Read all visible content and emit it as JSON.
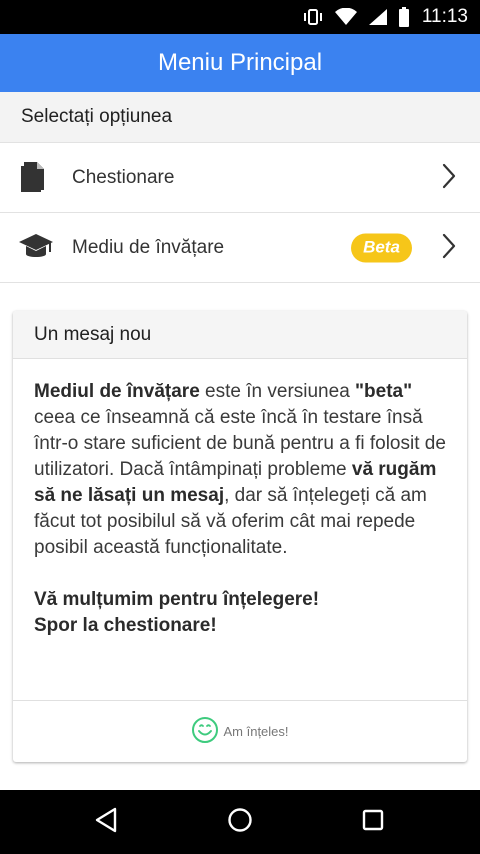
{
  "status_bar": {
    "time": "11:13",
    "icons": [
      "vibrate-icon",
      "wifi-icon",
      "signal-icon",
      "battery-icon"
    ]
  },
  "app_bar": {
    "title": "Meniu Principal"
  },
  "section": {
    "title": "Selectați opțiunea"
  },
  "menu": {
    "items": [
      {
        "label": "Chestionare",
        "icon": "document-icon"
      },
      {
        "label": "Mediu de învățare",
        "icon": "graduation-cap-icon",
        "badge": "Beta"
      }
    ]
  },
  "message": {
    "title": "Un mesaj nou",
    "paragraph": {
      "p1_bold": "Mediul de învățare",
      "p2": " este în versiunea ",
      "p3_bold": "\"beta\"",
      "p4": " ceea ce înseamnă că este încă în testare însă într-o stare suficient de bună pentru a fi folosit de utilizatori. Dacă întâmpinați probleme ",
      "p5_bold": "vă rugăm să ne lăsați un mesaj",
      "p6": ", dar să înțelegeți că am făcut tot posibilul să vă oferim cât mai repede posibil această funcționalitate."
    },
    "thanks_line1": "Vă mulțumim pentru înțelegere!",
    "thanks_line2": "Spor la chestionare!",
    "ack_label": "Am înțeles!"
  },
  "nav": {
    "back": "back-icon",
    "home": "home-icon",
    "recents": "recents-icon"
  },
  "colors": {
    "app_bar": "#3b82f0",
    "badge": "#f6c619",
    "smile": "#3ecb7e"
  }
}
